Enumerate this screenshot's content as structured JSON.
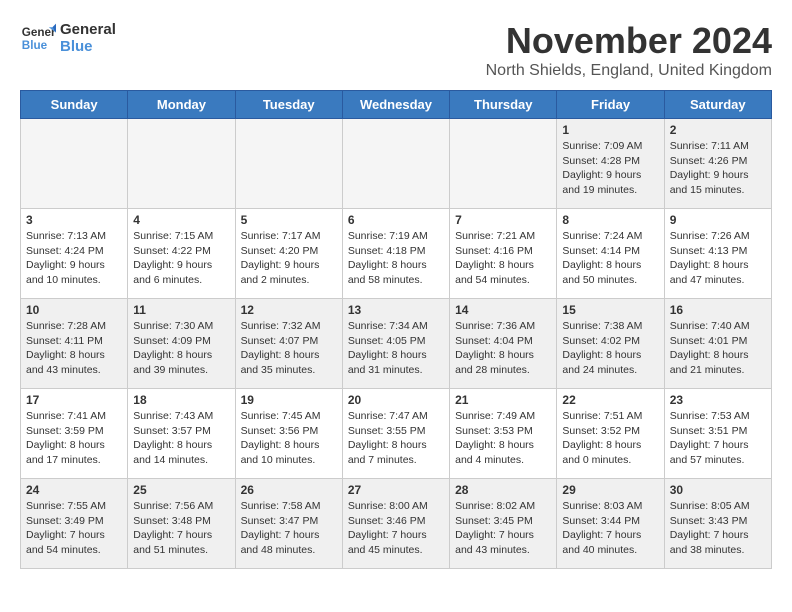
{
  "logo": {
    "line1": "General",
    "line2": "Blue"
  },
  "title": "November 2024",
  "location": "North Shields, England, United Kingdom",
  "weekdays": [
    "Sunday",
    "Monday",
    "Tuesday",
    "Wednesday",
    "Thursday",
    "Friday",
    "Saturday"
  ],
  "weeks": [
    [
      {
        "day": "",
        "info": ""
      },
      {
        "day": "",
        "info": ""
      },
      {
        "day": "",
        "info": ""
      },
      {
        "day": "",
        "info": ""
      },
      {
        "day": "",
        "info": ""
      },
      {
        "day": "1",
        "info": "Sunrise: 7:09 AM\nSunset: 4:28 PM\nDaylight: 9 hours\nand 19 minutes."
      },
      {
        "day": "2",
        "info": "Sunrise: 7:11 AM\nSunset: 4:26 PM\nDaylight: 9 hours\nand 15 minutes."
      }
    ],
    [
      {
        "day": "3",
        "info": "Sunrise: 7:13 AM\nSunset: 4:24 PM\nDaylight: 9 hours\nand 10 minutes."
      },
      {
        "day": "4",
        "info": "Sunrise: 7:15 AM\nSunset: 4:22 PM\nDaylight: 9 hours\nand 6 minutes."
      },
      {
        "day": "5",
        "info": "Sunrise: 7:17 AM\nSunset: 4:20 PM\nDaylight: 9 hours\nand 2 minutes."
      },
      {
        "day": "6",
        "info": "Sunrise: 7:19 AM\nSunset: 4:18 PM\nDaylight: 8 hours\nand 58 minutes."
      },
      {
        "day": "7",
        "info": "Sunrise: 7:21 AM\nSunset: 4:16 PM\nDaylight: 8 hours\nand 54 minutes."
      },
      {
        "day": "8",
        "info": "Sunrise: 7:24 AM\nSunset: 4:14 PM\nDaylight: 8 hours\nand 50 minutes."
      },
      {
        "day": "9",
        "info": "Sunrise: 7:26 AM\nSunset: 4:13 PM\nDaylight: 8 hours\nand 47 minutes."
      }
    ],
    [
      {
        "day": "10",
        "info": "Sunrise: 7:28 AM\nSunset: 4:11 PM\nDaylight: 8 hours\nand 43 minutes."
      },
      {
        "day": "11",
        "info": "Sunrise: 7:30 AM\nSunset: 4:09 PM\nDaylight: 8 hours\nand 39 minutes."
      },
      {
        "day": "12",
        "info": "Sunrise: 7:32 AM\nSunset: 4:07 PM\nDaylight: 8 hours\nand 35 minutes."
      },
      {
        "day": "13",
        "info": "Sunrise: 7:34 AM\nSunset: 4:05 PM\nDaylight: 8 hours\nand 31 minutes."
      },
      {
        "day": "14",
        "info": "Sunrise: 7:36 AM\nSunset: 4:04 PM\nDaylight: 8 hours\nand 28 minutes."
      },
      {
        "day": "15",
        "info": "Sunrise: 7:38 AM\nSunset: 4:02 PM\nDaylight: 8 hours\nand 24 minutes."
      },
      {
        "day": "16",
        "info": "Sunrise: 7:40 AM\nSunset: 4:01 PM\nDaylight: 8 hours\nand 21 minutes."
      }
    ],
    [
      {
        "day": "17",
        "info": "Sunrise: 7:41 AM\nSunset: 3:59 PM\nDaylight: 8 hours\nand 17 minutes."
      },
      {
        "day": "18",
        "info": "Sunrise: 7:43 AM\nSunset: 3:57 PM\nDaylight: 8 hours\nand 14 minutes."
      },
      {
        "day": "19",
        "info": "Sunrise: 7:45 AM\nSunset: 3:56 PM\nDaylight: 8 hours\nand 10 minutes."
      },
      {
        "day": "20",
        "info": "Sunrise: 7:47 AM\nSunset: 3:55 PM\nDaylight: 8 hours\nand 7 minutes."
      },
      {
        "day": "21",
        "info": "Sunrise: 7:49 AM\nSunset: 3:53 PM\nDaylight: 8 hours\nand 4 minutes."
      },
      {
        "day": "22",
        "info": "Sunrise: 7:51 AM\nSunset: 3:52 PM\nDaylight: 8 hours\nand 0 minutes."
      },
      {
        "day": "23",
        "info": "Sunrise: 7:53 AM\nSunset: 3:51 PM\nDaylight: 7 hours\nand 57 minutes."
      }
    ],
    [
      {
        "day": "24",
        "info": "Sunrise: 7:55 AM\nSunset: 3:49 PM\nDaylight: 7 hours\nand 54 minutes."
      },
      {
        "day": "25",
        "info": "Sunrise: 7:56 AM\nSunset: 3:48 PM\nDaylight: 7 hours\nand 51 minutes."
      },
      {
        "day": "26",
        "info": "Sunrise: 7:58 AM\nSunset: 3:47 PM\nDaylight: 7 hours\nand 48 minutes."
      },
      {
        "day": "27",
        "info": "Sunrise: 8:00 AM\nSunset: 3:46 PM\nDaylight: 7 hours\nand 45 minutes."
      },
      {
        "day": "28",
        "info": "Sunrise: 8:02 AM\nSunset: 3:45 PM\nDaylight: 7 hours\nand 43 minutes."
      },
      {
        "day": "29",
        "info": "Sunrise: 8:03 AM\nSunset: 3:44 PM\nDaylight: 7 hours\nand 40 minutes."
      },
      {
        "day": "30",
        "info": "Sunrise: 8:05 AM\nSunset: 3:43 PM\nDaylight: 7 hours\nand 38 minutes."
      }
    ]
  ]
}
